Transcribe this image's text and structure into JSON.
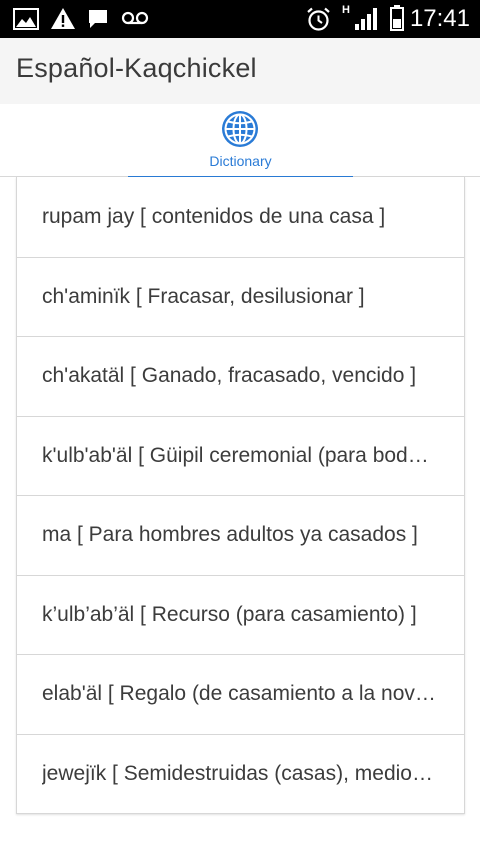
{
  "status_bar": {
    "time": "17:41",
    "network_label": "H",
    "icons": [
      "gallery-icon",
      "warning-icon",
      "message-icon",
      "voicemail-icon",
      "alarm-icon",
      "signal-icon",
      "battery-icon"
    ]
  },
  "app_bar": {
    "title": "Español-Kaqchickel"
  },
  "tabs": [
    {
      "label": "Dictionary",
      "icon": "globe-icon",
      "selected": true
    }
  ],
  "colors": {
    "accent": "#2a7bd6",
    "status_bar_bg": "#000000",
    "app_bar_bg": "#f5f5f5"
  },
  "entries": [
    {
      "text": "rupam jay [ contenidos de una casa ]"
    },
    {
      "text": "ch'aminïk [ Fracasar, desilusionar ]"
    },
    {
      "text": "ch'akatäl [ Ganado, fracasado, vencido ]"
    },
    {
      "text": "k'ulb'ab'äl [ Güipil ceremonial (para bodas) ]"
    },
    {
      "text": "ma [ Para hombres adultos ya casados ]"
    },
    {
      "text": "k’ulb’ab’äl [ Recurso (para casamiento) ]"
    },
    {
      "text": "elab'äl [ Regalo (de casamiento a la novia) ]"
    },
    {
      "text": "jewejïk [ Semidestruidas (casas), medio caídas ]"
    }
  ]
}
